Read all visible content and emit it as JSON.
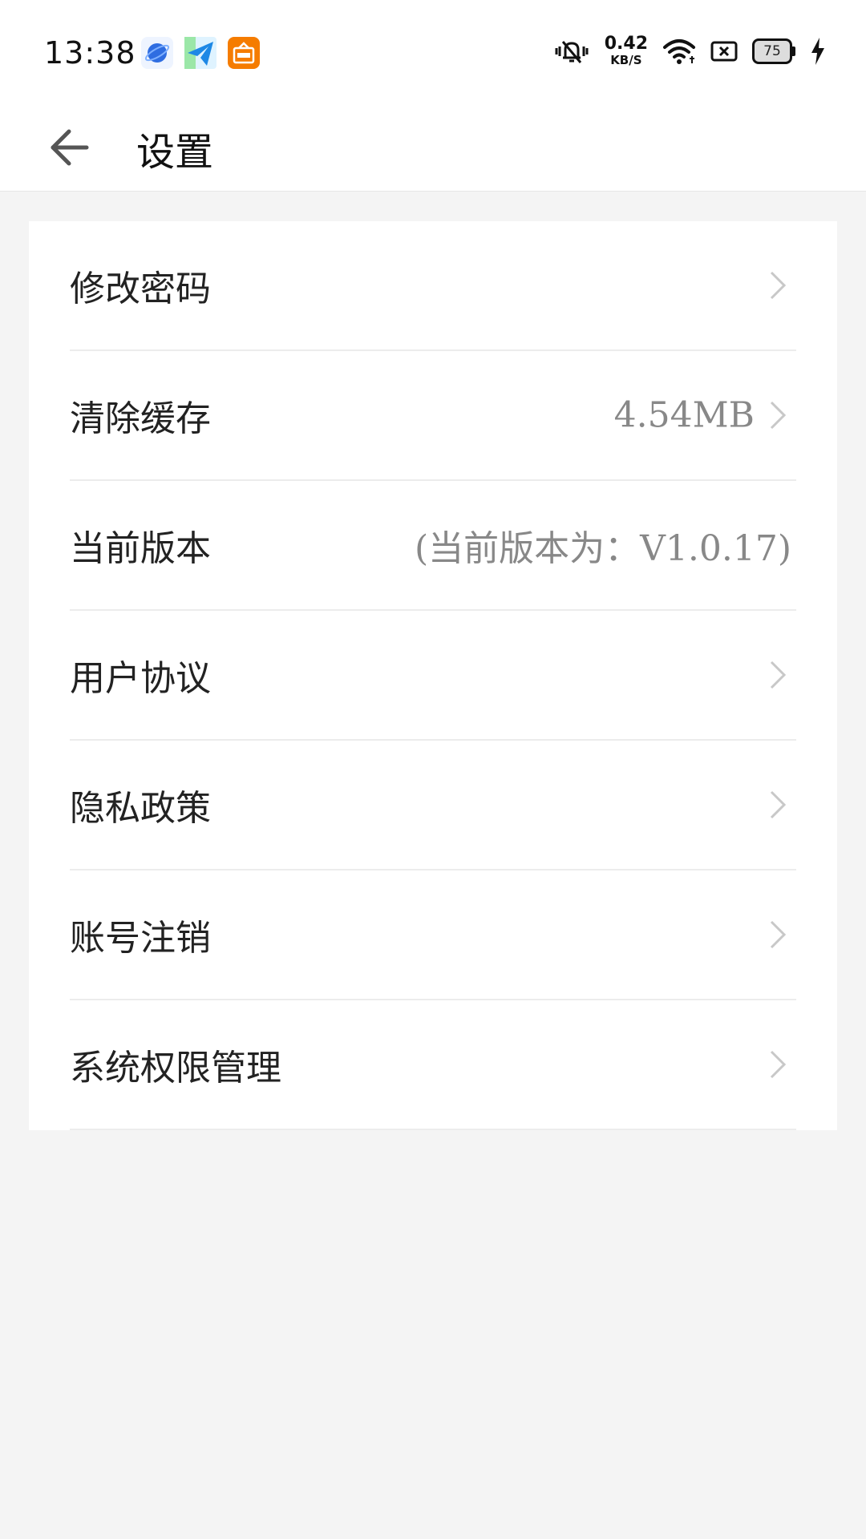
{
  "status_bar": {
    "time": "13:38",
    "net_speed_value": "0.42",
    "net_speed_unit": "KB/S",
    "battery_level": "75",
    "notification_icons": [
      "browser-app-icon",
      "telegram-icon",
      "hot-app-icon"
    ],
    "system_icons": [
      "mute-vibrate-icon",
      "wifi-icon",
      "sim-missing-icon",
      "battery-icon",
      "charging-icon"
    ]
  },
  "header": {
    "title": "设置",
    "back_icon": "back-arrow-icon"
  },
  "settings": {
    "items": [
      {
        "label": "修改密码",
        "value": "",
        "chevron": true
      },
      {
        "label": "清除缓存",
        "value": "4.54MB",
        "chevron": true
      },
      {
        "label": "当前版本",
        "value": "(当前版本为：V1.0.17)",
        "chevron": false
      },
      {
        "label": "用户协议",
        "value": "",
        "chevron": true
      },
      {
        "label": "隐私政策",
        "value": "",
        "chevron": true
      },
      {
        "label": "账号注销",
        "value": "",
        "chevron": true
      },
      {
        "label": "系统权限管理",
        "value": "",
        "chevron": true
      }
    ]
  },
  "colors": {
    "background": "#f4f4f4",
    "card": "#ffffff",
    "divider": "#ececec",
    "label_text": "#222222",
    "value_text": "#888888",
    "chevron": "#c8c8c8"
  }
}
